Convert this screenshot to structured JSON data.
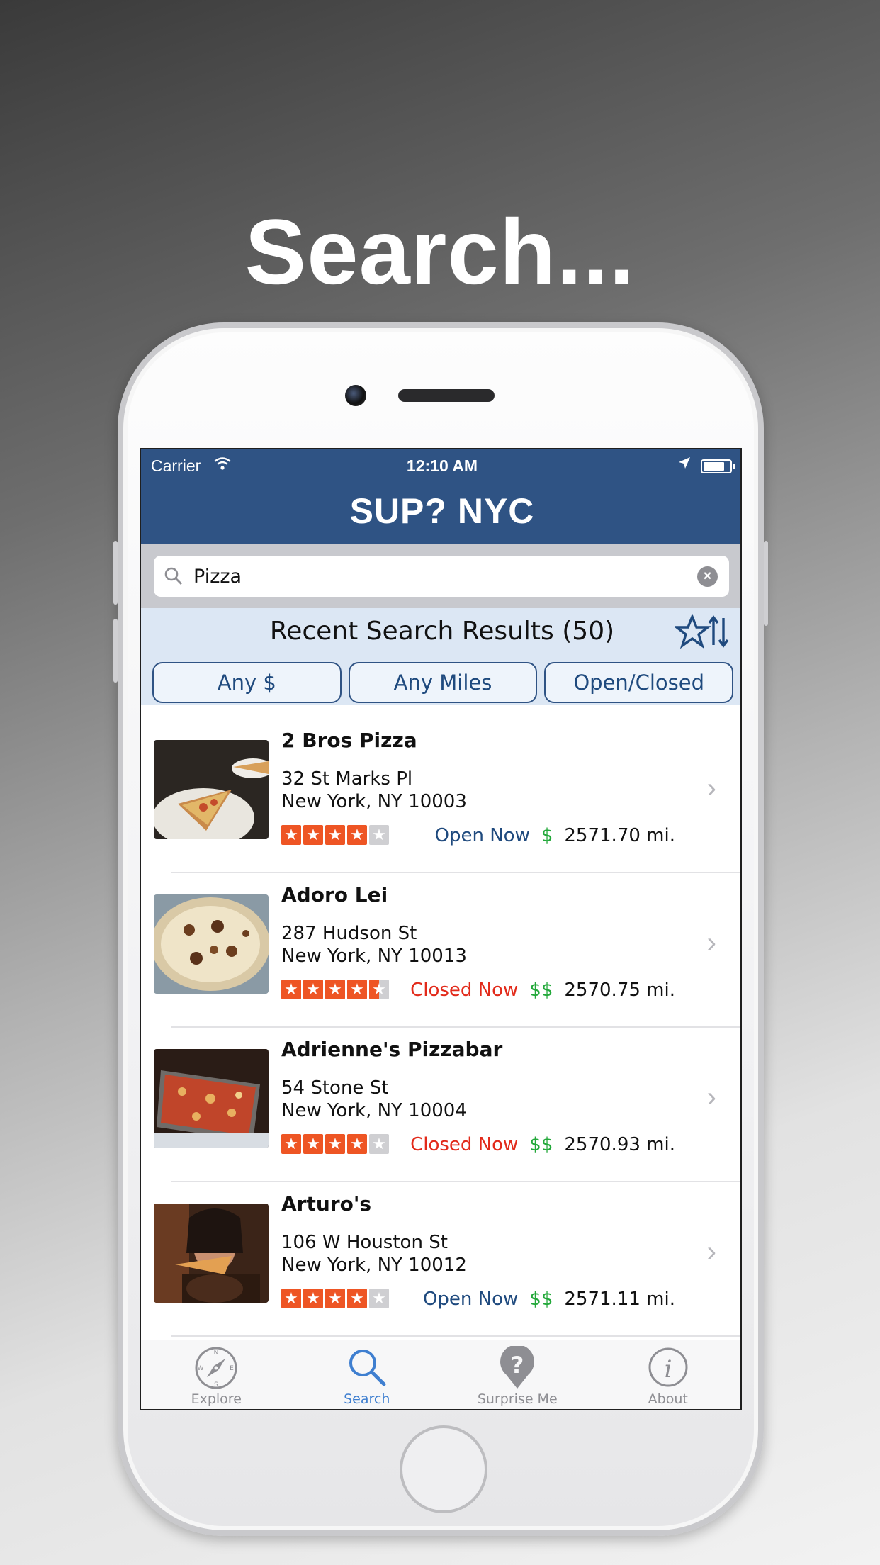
{
  "headline": "Search...",
  "status_bar": {
    "carrier": "Carrier",
    "time": "12:10 AM"
  },
  "app": {
    "title": "SUP? NYC"
  },
  "search": {
    "value": "Pizza",
    "placeholder": ""
  },
  "results": {
    "title": "Recent Search Results (50)",
    "filters": [
      {
        "label": "Any $"
      },
      {
        "label": "Any Miles"
      },
      {
        "label": "Open/Closed"
      }
    ],
    "items": [
      {
        "name": "2 Bros Pizza",
        "address1": "32 St Marks Pl",
        "address2": "New York, NY 10003",
        "rating": 4,
        "status": "Open Now",
        "price": "$",
        "distance": "2571.70 mi."
      },
      {
        "name": "Adoro Lei",
        "address1": "287 Hudson St",
        "address2": "New York, NY 10013",
        "rating": 4.5,
        "status": "Closed Now",
        "price": "$$",
        "distance": "2570.75 mi."
      },
      {
        "name": "Adrienne's Pizzabar",
        "address1": "54 Stone St",
        "address2": "New York, NY 10004",
        "rating": 4,
        "status": "Closed Now",
        "price": "$$",
        "distance": "2570.93 mi."
      },
      {
        "name": "Arturo's",
        "address1": "106 W Houston St",
        "address2": "New York, NY 10012",
        "rating": 4,
        "status": "Open Now",
        "price": "$$",
        "distance": "2571.11 mi."
      }
    ]
  },
  "tabbar": {
    "tabs": [
      {
        "label": "Explore",
        "icon": "compass-icon"
      },
      {
        "label": "Search",
        "icon": "search-icon",
        "active": true
      },
      {
        "label": "Surprise Me",
        "icon": "question-pin-icon"
      },
      {
        "label": "About",
        "icon": "info-icon"
      }
    ]
  },
  "colors": {
    "navbar": "#2f5384",
    "star": "#ee5524",
    "open": "#1f4a7e",
    "closed": "#e22a1a",
    "price": "#23a83a",
    "tab_active": "#3f7fd0"
  }
}
